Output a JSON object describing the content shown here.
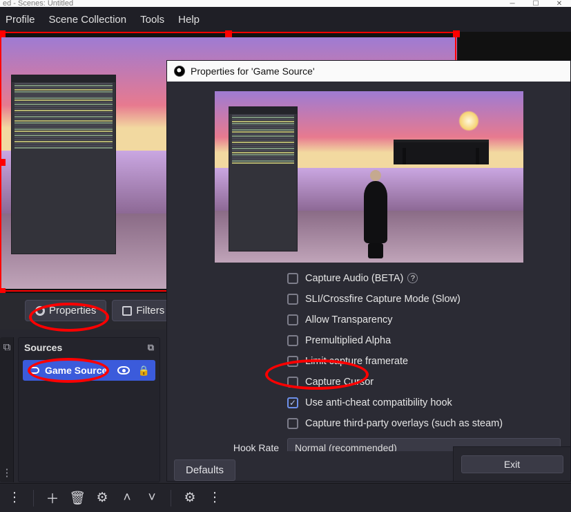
{
  "window": {
    "title": "ed - Scenes: Untitled"
  },
  "menu": {
    "profile": "Profile",
    "scene_collection": "Scene Collection",
    "tools": "Tools",
    "help": "Help"
  },
  "toolbar": {
    "properties": "Properties",
    "filters": "Filters"
  },
  "sources": {
    "header": "Sources",
    "items": [
      {
        "label": "Game Source"
      }
    ]
  },
  "dialog": {
    "title": "Properties for 'Game Source'",
    "checks": {
      "capture_audio": "Capture Audio (BETA)",
      "sli_crossfire": "SLI/Crossfire Capture Mode (Slow)",
      "allow_transparency": "Allow Transparency",
      "premultiplied_alpha": "Premultiplied Alpha",
      "limit_framerate": "Limit capture framerate",
      "capture_cursor": "Capture Cursor",
      "anti_cheat": "Use anti-cheat compatibility hook",
      "third_party": "Capture third-party overlays (such as steam)"
    },
    "hook_rate": {
      "label": "Hook Rate",
      "value": "Normal (recommended)"
    },
    "defaults": "Defaults",
    "exit": "Exit"
  }
}
